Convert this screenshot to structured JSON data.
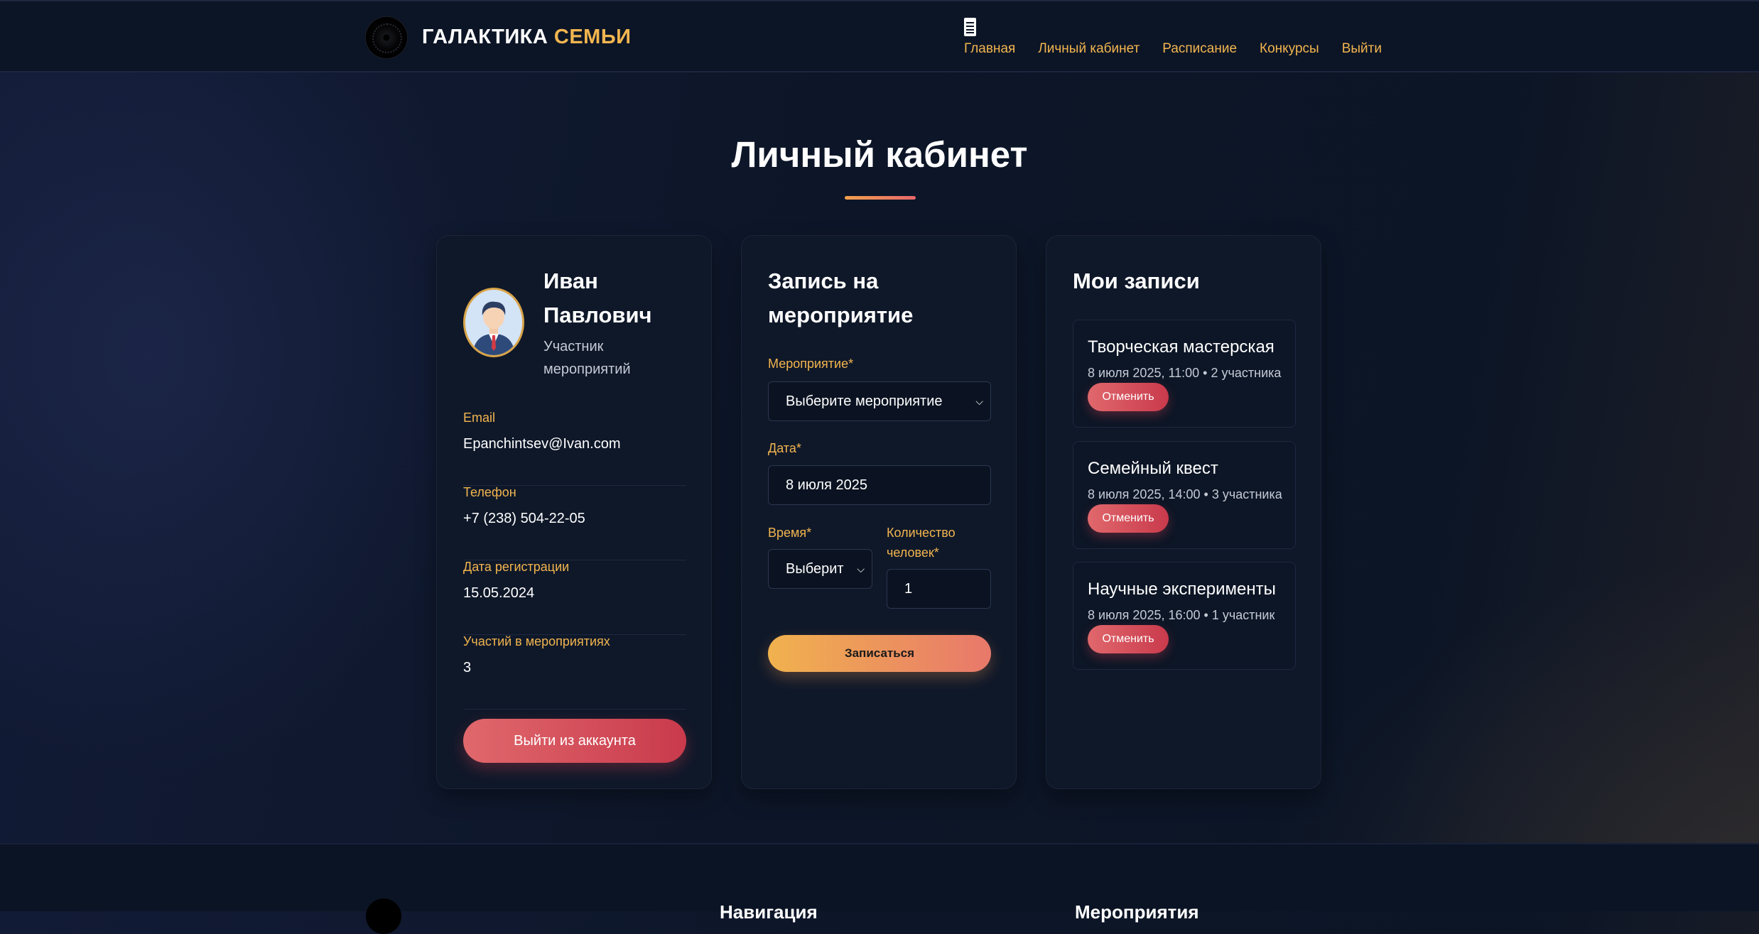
{
  "header": {
    "brand_part1": "ГАЛАКТИКА",
    "brand_part2": "СЕМЬИ",
    "menu_icon": "document-icon",
    "nav": [
      "Главная",
      "Личный кабинет",
      "Расписание",
      "Конкурсы",
      "Выйти"
    ]
  },
  "page_title": "Личный кабинет",
  "profile": {
    "name": "Иван Павлович",
    "role": "Участник мероприятий",
    "fields": [
      {
        "label": "Email",
        "value": "Epanchintsev@Ivan.com"
      },
      {
        "label": "Телефон",
        "value": "+7 (238) 504-22-05"
      },
      {
        "label": "Дата регистрации",
        "value": "15.05.2024"
      },
      {
        "label": "Участий в мероприятиях",
        "value": "3"
      }
    ],
    "logout_label": "Выйти из аккаунта"
  },
  "registration": {
    "title": "Запись на мероприятие",
    "event_label": "Мероприятие*",
    "event_value": "Выберите мероприятие",
    "date_label": "Дата*",
    "date_value": "8 июля 2025",
    "time_label": "Время*",
    "time_value": "Выберит",
    "count_label": "Количество человек*",
    "count_value": "1",
    "submit_label": "Записаться"
  },
  "bookings": {
    "title": "Мои записи",
    "cancel_label": "Отменить",
    "items": [
      {
        "title": "Творческая мастерская",
        "meta": "8 июля 2025, 11:00 • 2 участника"
      },
      {
        "title": "Семейный квест",
        "meta": "8 июля 2025, 14:00 • 3 участника"
      },
      {
        "title": "Научные эксперименты",
        "meta": "8 июля 2025, 16:00 • 1 участник"
      }
    ]
  },
  "footer": {
    "col1": "Навигация",
    "col2": "Мероприятия"
  },
  "colors": {
    "accent": "#f2b54f",
    "danger": "#d0474f",
    "background": "#0c1526"
  }
}
